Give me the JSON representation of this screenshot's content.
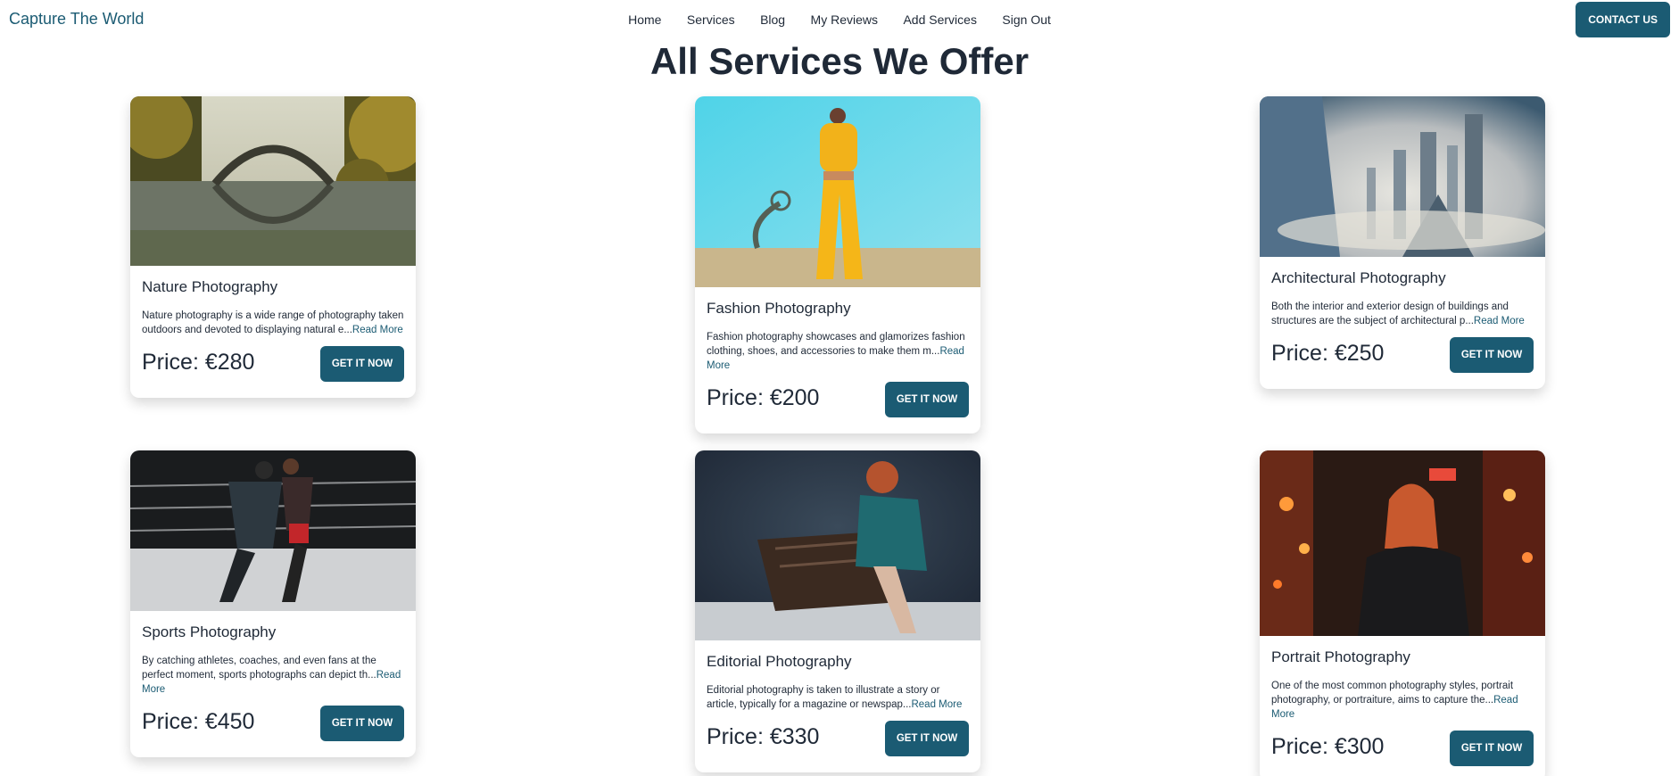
{
  "nav": {
    "brand": "Capture The World",
    "links": [
      "Home",
      "Services",
      "Blog",
      "My Reviews",
      "Add Services",
      "Sign Out"
    ],
    "contact": "CONTACT US"
  },
  "page": {
    "title": "All Services We Offer"
  },
  "services": [
    {
      "title": "Nature Photography",
      "desc": "Nature photography is a wide range of photography taken outdoors and devoted to displaying natural e...",
      "read_more": "Read More",
      "price": "Price: €280",
      "button": "GET IT NOW",
      "image": "stone-bridge-reflection-photo"
    },
    {
      "title": "Fashion Photography",
      "desc": "Fashion photography showcases and glamorizes fashion clothing, shoes, and accessories to make them m...",
      "read_more": "Read More",
      "price": "Price: €200",
      "button": "GET IT NOW",
      "image": "model-yellow-tracksuit-photo"
    },
    {
      "title": "Architectural Photography",
      "desc": "Both the interior and exterior design of buildings and structures are the subject of architectural p...",
      "read_more": "Read More",
      "price": "Price: €250",
      "button": "GET IT NOW",
      "image": "skyscrapers-above-clouds-photo"
    },
    {
      "title": "Sports Photography",
      "desc": "By catching athletes, coaches, and even fans at the perfect moment, sports photographs can depict th...",
      "read_more": "Read More",
      "price": "Price: €450",
      "button": "GET IT NOW",
      "image": "kickboxing-ring-photo"
    },
    {
      "title": "Editorial Photography",
      "desc": "Editorial photography is taken to illustrate a story or article, typically for a magazine or newspap...",
      "read_more": "Read More",
      "price": "Price: €330",
      "button": "GET IT NOW",
      "image": "woman-on-snowy-bench-photo"
    },
    {
      "title": "Portrait Photography",
      "desc": "One of the most common photography styles, portrait photography, or portraiture, aims to capture the...",
      "read_more": "Read More",
      "price": "Price: €300",
      "button": "GET IT NOW",
      "image": "redhead-city-night-photo"
    }
  ]
}
